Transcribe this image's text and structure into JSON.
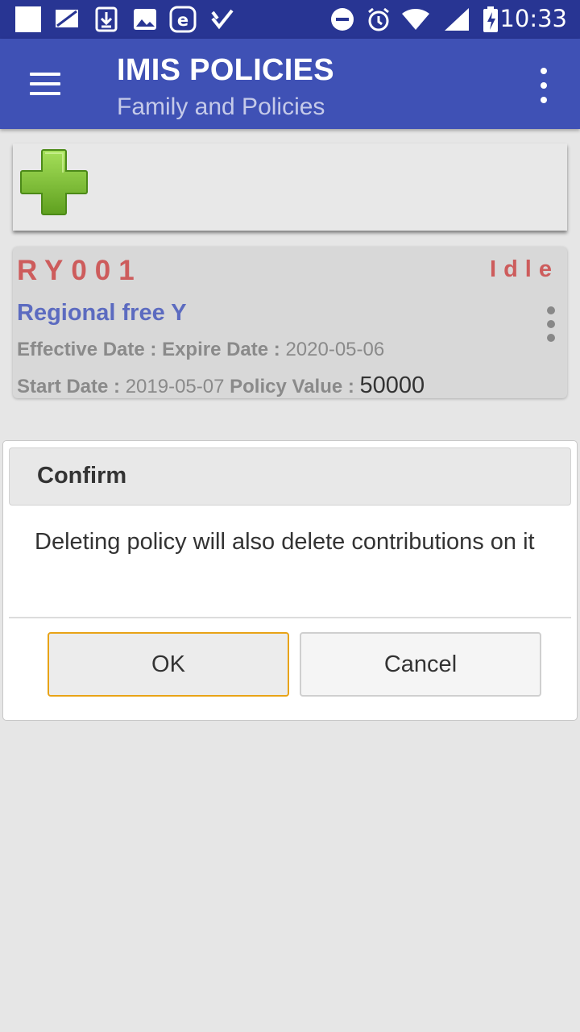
{
  "status_bar": {
    "time": "10:33",
    "icons": [
      "square-icon",
      "no-sim-icon",
      "download-icon",
      "image-icon",
      "e-icon",
      "check-icon",
      "dnd-icon",
      "alarm-icon",
      "wifi-icon",
      "signal-icon",
      "battery-charging-icon"
    ]
  },
  "toolbar": {
    "title": "IMIS POLICIES",
    "subtitle": "Family and Policies"
  },
  "policy": {
    "code": "RY001",
    "status": "Idle",
    "product": "Regional free Y",
    "effective_label": "Effective Date :",
    "expire_label": "Expire Date :",
    "expire_value": "2020-05-06",
    "start_label": "Start Date :",
    "start_value": "2019-05-07",
    "value_label": "Policy Value :",
    "value": "50000"
  },
  "dialog": {
    "title": "Confirm",
    "message": "Deleting policy will also delete contributions on it",
    "ok_label": "OK",
    "cancel_label": "Cancel"
  },
  "colors": {
    "status_bar": "#283593",
    "toolbar": "#3f51b5",
    "policy_code": "#cd5c5c",
    "product_name": "#5c6bc0",
    "ok_border": "#e8a317",
    "plus_green": "#7cc531"
  }
}
